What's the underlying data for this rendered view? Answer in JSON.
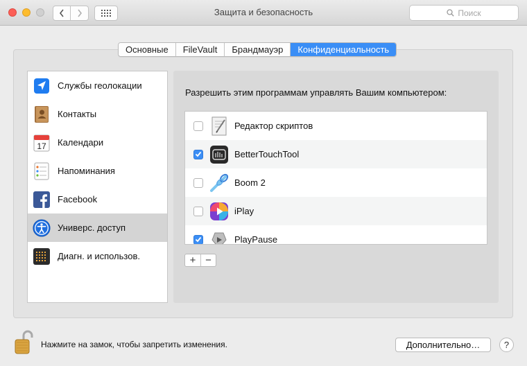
{
  "window": {
    "title": "Защита и безопасность",
    "search_placeholder": "Поиск"
  },
  "tabs": [
    {
      "label": "Основные",
      "active": false
    },
    {
      "label": "FileVault",
      "active": false
    },
    {
      "label": "Брандмауэр",
      "active": false
    },
    {
      "label": "Конфиденциальность",
      "active": true
    }
  ],
  "sidebar": {
    "items": [
      {
        "label": "Службы геолокации",
        "icon": "location-arrow-icon",
        "selected": false
      },
      {
        "label": "Контакты",
        "icon": "contacts-book-icon",
        "selected": false
      },
      {
        "label": "Календари",
        "icon": "calendar-icon",
        "calendar_day": "17",
        "selected": false
      },
      {
        "label": "Напоминания",
        "icon": "reminders-icon",
        "selected": false
      },
      {
        "label": "Facebook",
        "icon": "facebook-icon",
        "selected": false
      },
      {
        "label": "Универс. доступ",
        "icon": "accessibility-icon",
        "selected": true
      },
      {
        "label": "Диагн. и использов.",
        "icon": "diagnostics-icon",
        "selected": false
      }
    ]
  },
  "main": {
    "prompt": "Разрешить этим программам управлять Вашим компьютером:",
    "apps": [
      {
        "name": "Редактор скриптов",
        "checked": false,
        "icon": "script-editor-icon"
      },
      {
        "name": "BetterTouchTool",
        "checked": true,
        "icon": "bettertouchtool-icon"
      },
      {
        "name": "Boom 2",
        "checked": false,
        "icon": "boom2-icon"
      },
      {
        "name": "iPlay",
        "checked": false,
        "icon": "iplay-icon"
      },
      {
        "name": "PlayPause",
        "checked": true,
        "icon": "playpause-icon"
      }
    ],
    "add_label": "+",
    "remove_label": "−"
  },
  "footer": {
    "lock_text": "Нажмите на замок, чтобы запретить изменения.",
    "advanced_label": "Дополнительно…",
    "help_label": "?"
  },
  "colors": {
    "accent": "#3a8ef6",
    "selected_row": "#d4d4d4"
  }
}
